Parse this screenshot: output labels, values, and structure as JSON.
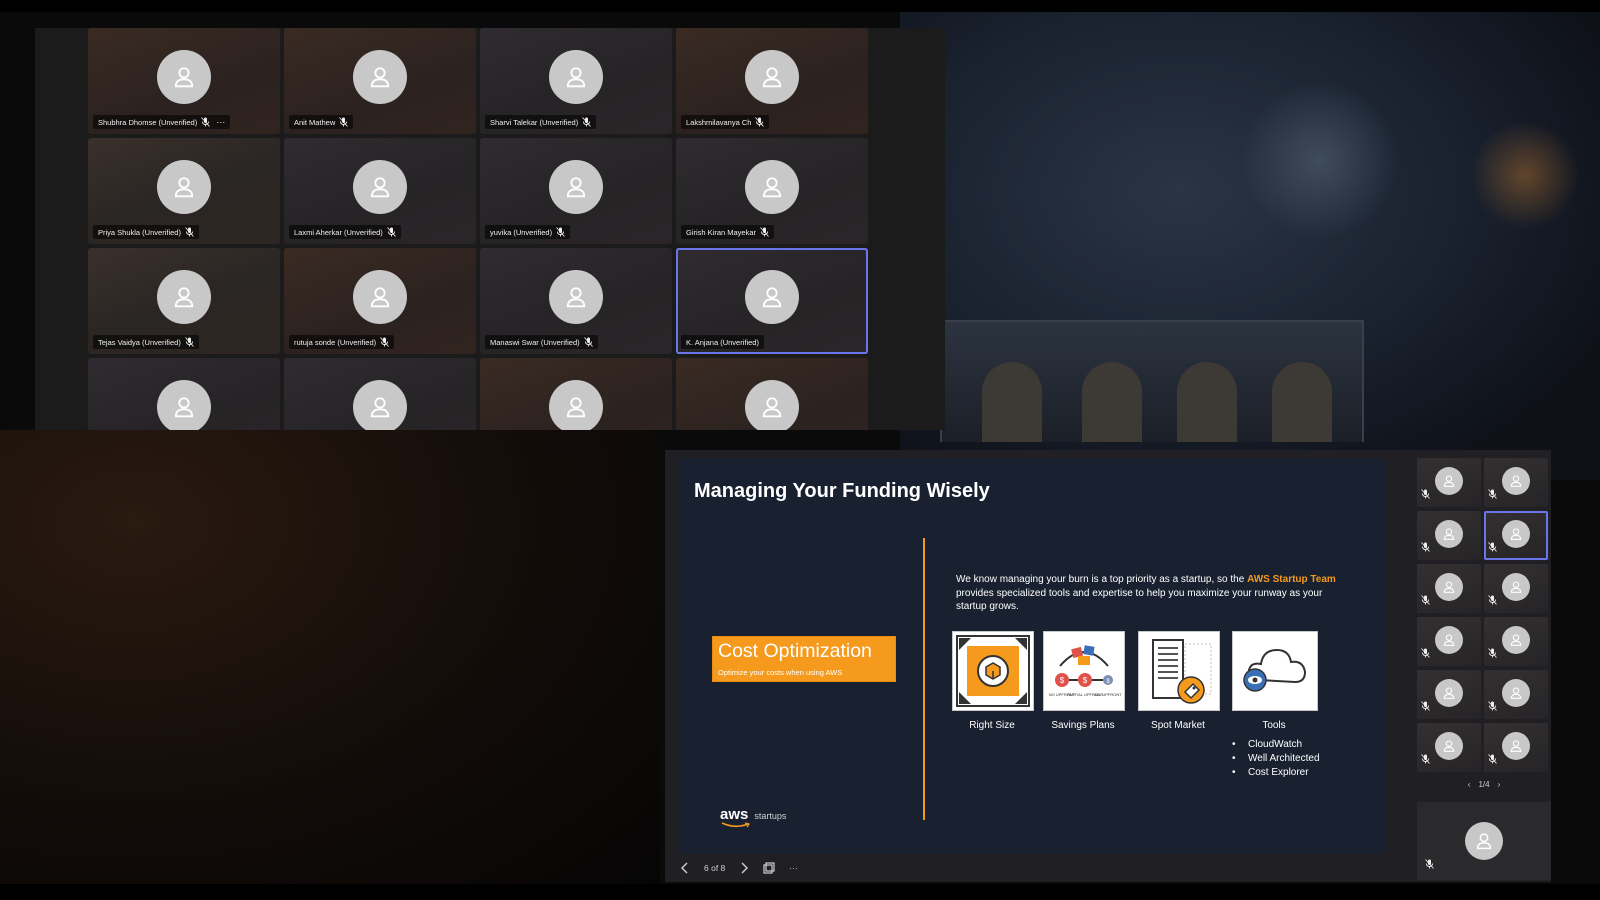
{
  "gallery": {
    "participants": [
      {
        "name": "Shubhra Dhomse (Unverified)",
        "more": "···"
      },
      {
        "name": "Anit Mathew"
      },
      {
        "name": "Sharvi Talekar (Unverified)"
      },
      {
        "name": "Lakshmilavanya Ch"
      },
      {
        "name": "Priya Shukla (Unverified)"
      },
      {
        "name": "Laxmi Aherkar (Unverified)"
      },
      {
        "name": "yuvika (Unverified)"
      },
      {
        "name": "Girish Kiran Mayekar"
      },
      {
        "name": "Tejas Vaidya (Unverified)"
      },
      {
        "name": "rutuja sonde (Unverified)"
      },
      {
        "name": "Manaswi Swar (Unverified)"
      },
      {
        "name": "K. Anjana (Unverified)"
      }
    ]
  },
  "slide": {
    "title": "Managing Your Funding Wisely",
    "cost_box": {
      "title": "Cost Optimization",
      "subtitle": "Optimize your costs when using AWS"
    },
    "intro_before": "We know managing your burn is a top priority as a startup, so the ",
    "intro_highlight": "AWS Startup Team",
    "intro_after": " provides specialized tools and expertise to help you maximize your runway as your startup grows.",
    "tools": [
      {
        "label": "Right Size"
      },
      {
        "label": "Savings Plans"
      },
      {
        "label": "Spot Market"
      },
      {
        "label": "Tools"
      }
    ],
    "savings_plan_captions": [
      "NO UPFRONT",
      "PARTIAL UPFRONT",
      "ALL UPFRONT"
    ],
    "bullets": [
      "CloudWatch",
      "Well Architected",
      "Cost Explorer"
    ],
    "logo": {
      "word": "aws",
      "suffix": "startups"
    },
    "colors": {
      "accent": "#f59a1d",
      "slide_bg": "#192131",
      "active_outline": "#6b74e8"
    }
  },
  "controls": {
    "prev_icon": "chevron-left-icon",
    "counter": "6 of 8",
    "next_icon": "chevron-right-icon",
    "popout_icon": "popout-icon",
    "more": "···"
  },
  "strip": {
    "pager": "1/4",
    "tile_count": 12,
    "active_index": 3
  }
}
